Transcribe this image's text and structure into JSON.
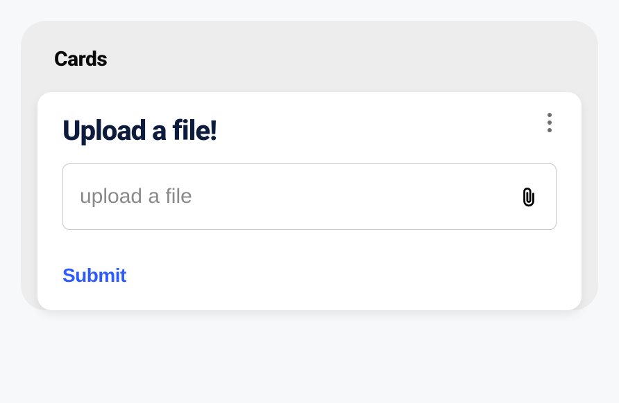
{
  "panel": {
    "title": "Cards"
  },
  "card": {
    "title": "Upload a file!",
    "input": {
      "placeholder": "upload a file",
      "value": ""
    },
    "submit_label": "Submit",
    "menu_icon": "more-vertical",
    "attach_icon": "paperclip"
  }
}
